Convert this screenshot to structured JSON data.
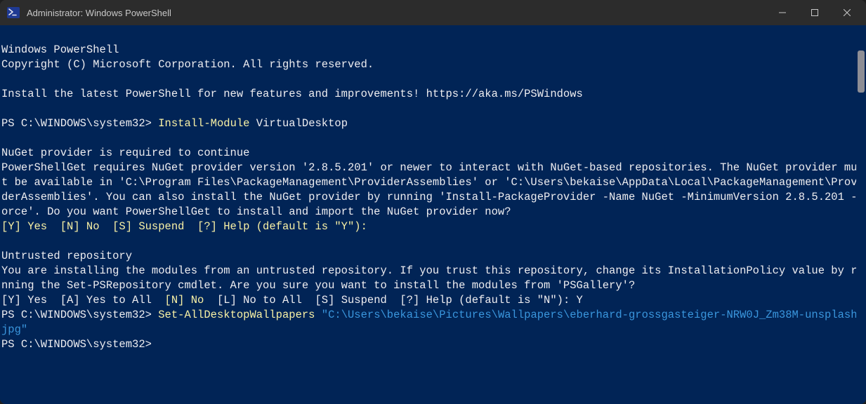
{
  "titlebar": {
    "title": "Administrator: Windows PowerShell"
  },
  "terminal": {
    "banner1": "Windows PowerShell",
    "banner2": "Copyright (C) Microsoft Corporation. All rights reserved.",
    "banner3": "Install the latest PowerShell for new features and improvements! https://aka.ms/PSWindows",
    "prompt1_prefix": "PS C:\\WINDOWS\\system32> ",
    "prompt1_cmd": "Install-Module",
    "prompt1_arg": " VirtualDesktop",
    "nuget_header": "NuGet provider is required to continue",
    "nuget_body": "PowerShellGet requires NuGet provider version '2.8.5.201' or newer to interact with NuGet-based repositories. The NuGet provider must be available in 'C:\\Program Files\\PackageManagement\\ProviderAssemblies' or 'C:\\Users\\bekaise\\AppData\\Local\\PackageManagement\\ProviderAssemblies'. You can also install the NuGet provider by running 'Install-PackageProvider -Name NuGet -MinimumVersion 2.8.5.201 -Force'. Do you want PowerShellGet to install and import the NuGet provider now?",
    "nuget_options": "[Y] Yes  [N] No  [S] Suspend  [?] Help (default is \"Y\"):",
    "untrusted_header": "Untrusted repository",
    "untrusted_body": "You are installing the modules from an untrusted repository. If you trust this repository, change its InstallationPolicy value by running the Set-PSRepository cmdlet. Are you sure you want to install the modules from 'PSGallery'?",
    "untrusted_options": "[Y] Yes  [A] Yes to All  ",
    "untrusted_no": "[N] No",
    "untrusted_options2": "  [L] No to All  [S] Suspend  [?] Help (default is \"N\"): Y",
    "prompt2_prefix": "PS C:\\WINDOWS\\system32> ",
    "prompt2_cmd": "Set-AllDesktopWallpapers ",
    "prompt2_arg": "\"C:\\Users\\bekaise\\Pictures\\Wallpapers\\eberhard-grossgasteiger-NRW0J_Zm38M-unsplash.jpg\"",
    "prompt3_prefix": "PS C:\\WINDOWS\\system32>"
  }
}
